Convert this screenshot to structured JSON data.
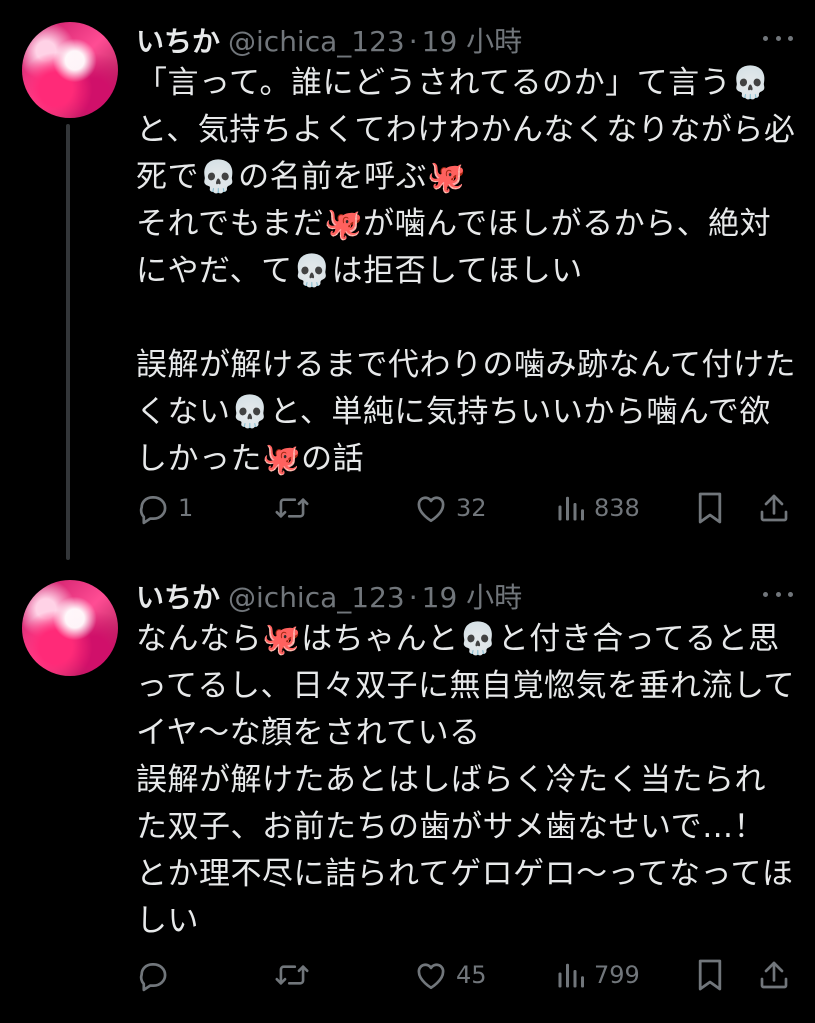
{
  "colors": {
    "background": "#000000",
    "text": "#e7e9ea",
    "secondary": "#71767b",
    "thread_line": "#333639"
  },
  "tweets": [
    {
      "display_name": "いちか",
      "handle": "@ichica_123",
      "separator": "·",
      "time": "19 小時",
      "text": "「言って。誰にどうされてるのか」て言う💀と、気持ちよくてわけわかんなくなりながら必死で💀の名前を呼ぶ🐙\nそれでもまだ🐙が噛んでほしがるから、絶対にやだ、て💀は拒否してほしい\n\n誤解が解けるまで代わりの噛み跡なんて付けたくない💀と、単純に気持ちいいから噛んで欲しかった🐙の話",
      "replies": "1",
      "retweets": "",
      "likes": "32",
      "views": "838",
      "icons": [
        "reply-icon",
        "retweet-icon",
        "like-icon",
        "views-icon",
        "bookmark-icon",
        "share-icon"
      ]
    },
    {
      "display_name": "いちか",
      "handle": "@ichica_123",
      "separator": "·",
      "time": "19 小時",
      "text": "なんなら🐙はちゃんと💀と付き合ってると思ってるし、日々双子に無自覚惚気を垂れ流してイヤ〜な顔をされている\n誤解が解けたあとはしばらく冷たく当たられた双子、お前たちの歯がサメ歯なせいで…！とか理不尽に詰られてゲロゲロ〜ってなってほしい",
      "replies": "",
      "retweets": "",
      "likes": "45",
      "views": "799",
      "icons": [
        "reply-icon",
        "retweet-icon",
        "like-icon",
        "views-icon",
        "bookmark-icon",
        "share-icon"
      ]
    }
  ]
}
